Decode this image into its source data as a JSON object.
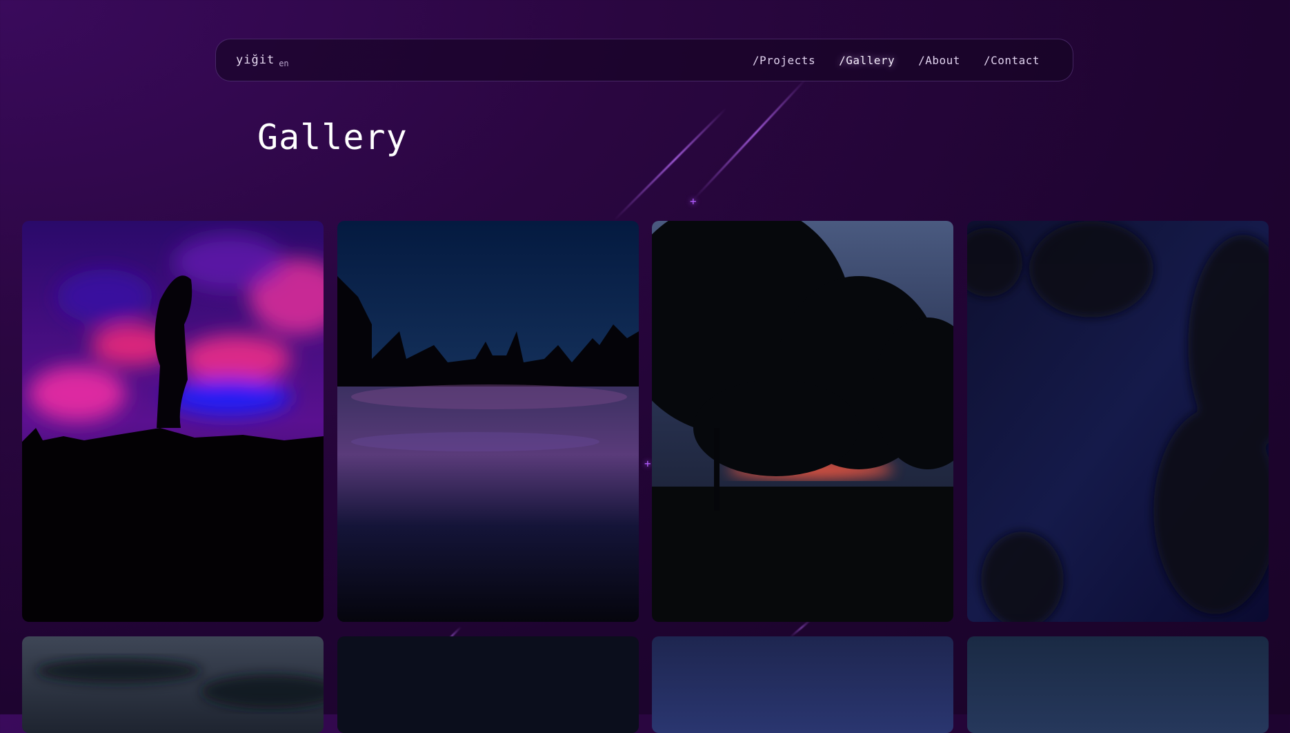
{
  "header": {
    "brand_name": "yiğit",
    "brand_lang": "en",
    "nav": [
      {
        "label": "/Projects",
        "active": false
      },
      {
        "label": "/Gallery",
        "active": true
      },
      {
        "label": "/About",
        "active": false
      },
      {
        "label": "/Contact",
        "active": false
      }
    ]
  },
  "page": {
    "title": "Gallery"
  },
  "gallery": {
    "photos": [
      {
        "name": "silhouette-pink-clouds"
      },
      {
        "name": "city-sunset-reflection"
      },
      {
        "name": "trees-dusk"
      },
      {
        "name": "night-sky-leaves"
      },
      {
        "name": "cloudy-sky"
      },
      {
        "name": "dark-night"
      },
      {
        "name": "blue-sky"
      },
      {
        "name": "blue-sky-2"
      }
    ]
  },
  "colors": {
    "background": "#1e0430",
    "accent": "#b25cff",
    "nav_border": "#6a4a8a"
  }
}
